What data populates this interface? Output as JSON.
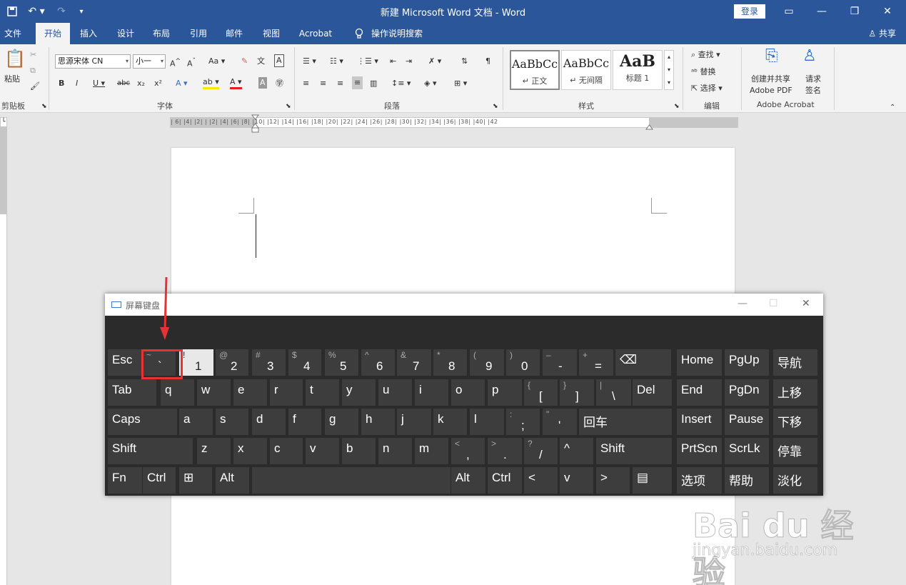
{
  "window": {
    "title": "新建 Microsoft Word 文档 - Word",
    "login": "登录"
  },
  "quick_access": {
    "save_icon": "save-icon",
    "undo_icon": "undo-icon",
    "redo_icon": "redo-icon"
  },
  "tabs": [
    "文件",
    "开始",
    "插入",
    "设计",
    "布局",
    "引用",
    "邮件",
    "视图",
    "Acrobat",
    "操作说明搜索"
  ],
  "share": "共享",
  "ribbon": {
    "clipboard": {
      "paste": "粘贴",
      "label": "剪贴板"
    },
    "font": {
      "name": "思源宋体 CN",
      "size": "小一",
      "label": "字体"
    },
    "paragraph": {
      "label": "段落"
    },
    "styles": {
      "items": [
        {
          "sample": "AaBbCc",
          "name": "↵ 正文"
        },
        {
          "sample": "AaBbCc",
          "name": "↵ 无间隔"
        },
        {
          "sample": "AaB",
          "name": "标题 1"
        }
      ],
      "label": "样式"
    },
    "editing": {
      "find": "查找",
      "replace": "替换",
      "select": "选择",
      "label": "编辑"
    },
    "acrobat": {
      "create": "创建并共享",
      "create2": "Adobe PDF",
      "sign": "请求",
      "sign2": "签名",
      "label": "Adobe Acrobat"
    }
  },
  "ruler": "|  6|  |4|  |2|  |  |2|  |4|  |6|  |8|  |10|  |12|  |14|  |16|  |18|  |20|  |22|  |24|  |26|  |28|  |30|  |32|  |34|  |36|  |38|  |40|  |42",
  "osk": {
    "title": "屏幕键盘",
    "rows": [
      [
        {
          "main": "Esc"
        },
        {
          "sh": "~",
          "ch": "`"
        },
        {
          "sh": "!",
          "ch": "1"
        },
        {
          "sh": "@",
          "ch": "2"
        },
        {
          "sh": "#",
          "ch": "3"
        },
        {
          "sh": "$",
          "ch": "4"
        },
        {
          "sh": "%",
          "ch": "5"
        },
        {
          "sh": "^",
          "ch": "6"
        },
        {
          "sh": "&",
          "ch": "7"
        },
        {
          "sh": "*",
          "ch": "8"
        },
        {
          "sh": "(",
          "ch": "9"
        },
        {
          "sh": ")",
          "ch": "0"
        },
        {
          "sh": "–",
          "ch": "-"
        },
        {
          "sh": "+",
          "ch": "="
        },
        {
          "main": "⌫"
        },
        {
          "main": "Home"
        },
        {
          "main": "PgUp"
        },
        {
          "main": "导航"
        }
      ],
      [
        {
          "main": "Tab"
        },
        {
          "main": "q"
        },
        {
          "main": "w"
        },
        {
          "main": "e"
        },
        {
          "main": "r"
        },
        {
          "main": "t"
        },
        {
          "main": "y"
        },
        {
          "main": "u"
        },
        {
          "main": "i"
        },
        {
          "main": "o"
        },
        {
          "main": "p"
        },
        {
          "sh": "{",
          "ch": "["
        },
        {
          "sh": "}",
          "ch": "]"
        },
        {
          "sh": "|",
          "ch": "\\"
        },
        {
          "main": "Del"
        },
        {
          "main": "End"
        },
        {
          "main": "PgDn"
        },
        {
          "main": "上移"
        }
      ],
      [
        {
          "main": "Caps"
        },
        {
          "main": "a"
        },
        {
          "main": "s"
        },
        {
          "main": "d"
        },
        {
          "main": "f"
        },
        {
          "main": "g"
        },
        {
          "main": "h"
        },
        {
          "main": "j"
        },
        {
          "main": "k"
        },
        {
          "main": "l"
        },
        {
          "sh": ":",
          "ch": ";"
        },
        {
          "sh": "\"",
          "ch": "'"
        },
        {
          "main": "回车"
        },
        {
          "main": "Insert"
        },
        {
          "main": "Pause"
        },
        {
          "main": "下移"
        }
      ],
      [
        {
          "main": "Shift"
        },
        {
          "main": "z"
        },
        {
          "main": "x"
        },
        {
          "main": "c"
        },
        {
          "main": "v"
        },
        {
          "main": "b"
        },
        {
          "main": "n"
        },
        {
          "main": "m"
        },
        {
          "sh": "<",
          "ch": ","
        },
        {
          "sh": ">",
          "ch": "."
        },
        {
          "sh": "?",
          "ch": "/"
        },
        {
          "main": "^"
        },
        {
          "main": "Shift"
        },
        {
          "main": "PrtScn"
        },
        {
          "main": "ScrLk"
        },
        {
          "main": "停靠"
        }
      ],
      [
        {
          "main": "Fn"
        },
        {
          "main": "Ctrl"
        },
        {
          "main": "⊞"
        },
        {
          "main": "Alt"
        },
        {
          "main": ""
        },
        {
          "main": "Alt"
        },
        {
          "main": "Ctrl"
        },
        {
          "main": "<"
        },
        {
          "main": "v"
        },
        {
          "main": ">"
        },
        {
          "main": "▤"
        },
        {
          "main": "选项"
        },
        {
          "main": "帮助"
        },
        {
          "main": "淡化"
        }
      ]
    ]
  },
  "watermark": {
    "logo": "Bai du 经验",
    "url": "jingyan.baidu.com"
  }
}
